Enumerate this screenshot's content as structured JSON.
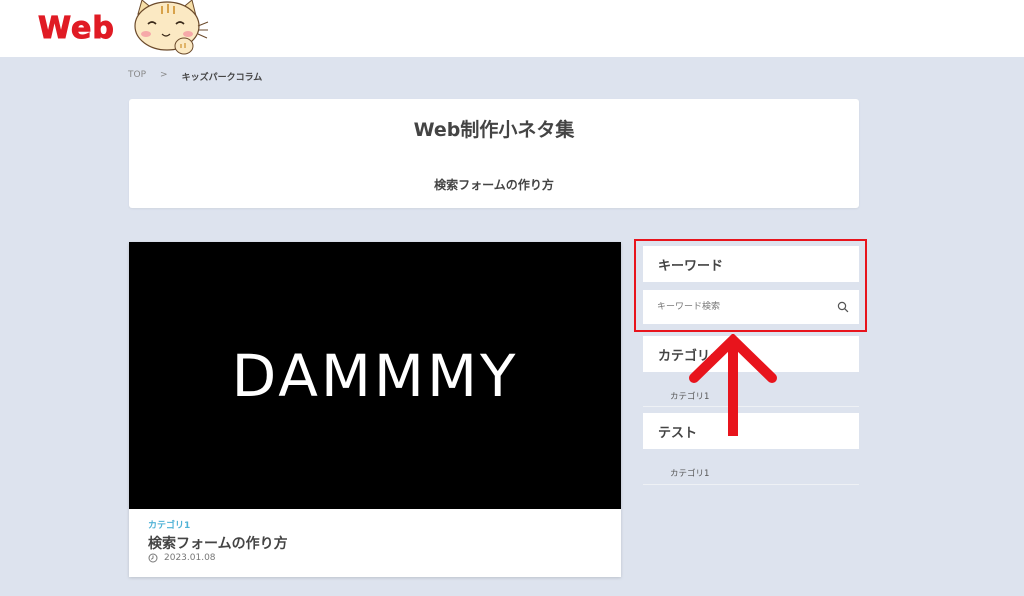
{
  "header": {
    "logo_text": "Web",
    "logo_color": "#e01b24",
    "mascot": "cat-mascot-icon"
  },
  "breadcrumb": {
    "home": "TOP",
    "separator": ">",
    "current": "キッズパークコラム"
  },
  "page_title": {
    "main": "Web制作小ネタ集",
    "sub": "検索フォームの作り方"
  },
  "article": {
    "thumbnail_text": "DAMMMY",
    "category": "カテゴリ1",
    "title": "検索フォームの作り方",
    "date": "2023.01.08",
    "category_color": "#4fb2d6"
  },
  "sidebar": {
    "keyword": {
      "heading": "キーワード",
      "placeholder": "キーワード検索"
    },
    "category": {
      "heading": "カテゴリー",
      "items": [
        "カテゴリ1"
      ]
    },
    "test": {
      "heading": "テスト",
      "items": [
        "カテゴリ1"
      ]
    }
  },
  "annotation": {
    "highlight_color": "#e8141c",
    "arrow_direction": "up"
  }
}
